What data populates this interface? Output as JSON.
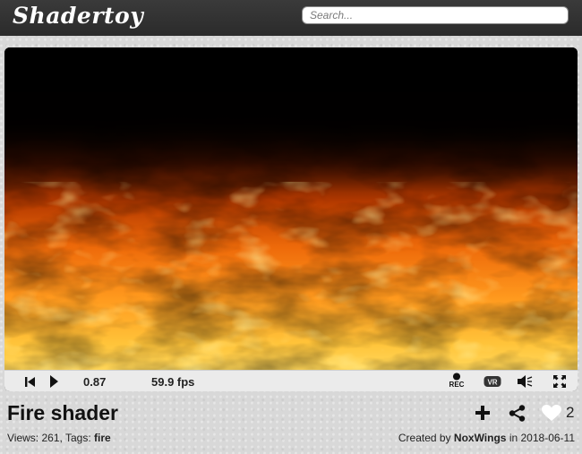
{
  "header": {
    "logo": "Shadertoy",
    "search_placeholder": "Search..."
  },
  "player": {
    "time": "0.87",
    "fps": "59.9 fps",
    "rec_label": "REC",
    "vr_label": "VR"
  },
  "shader": {
    "title": "Fire shader",
    "views_label": "Views:",
    "views": "261",
    "tags_label": "Tags:",
    "tag": "fire",
    "likes": "2",
    "created_by_label": "Created by",
    "author": "NoxWings",
    "in_label": "in",
    "date": "2018-06-11"
  },
  "icons": {
    "rewind": "rewind-icon",
    "play": "play-icon",
    "record": "record-icon",
    "vr": "vr-icon",
    "volume": "volume-icon",
    "fullscreen": "fullscreen-icon",
    "add": "plus-icon",
    "share": "share-icon",
    "like": "heart-icon"
  }
}
